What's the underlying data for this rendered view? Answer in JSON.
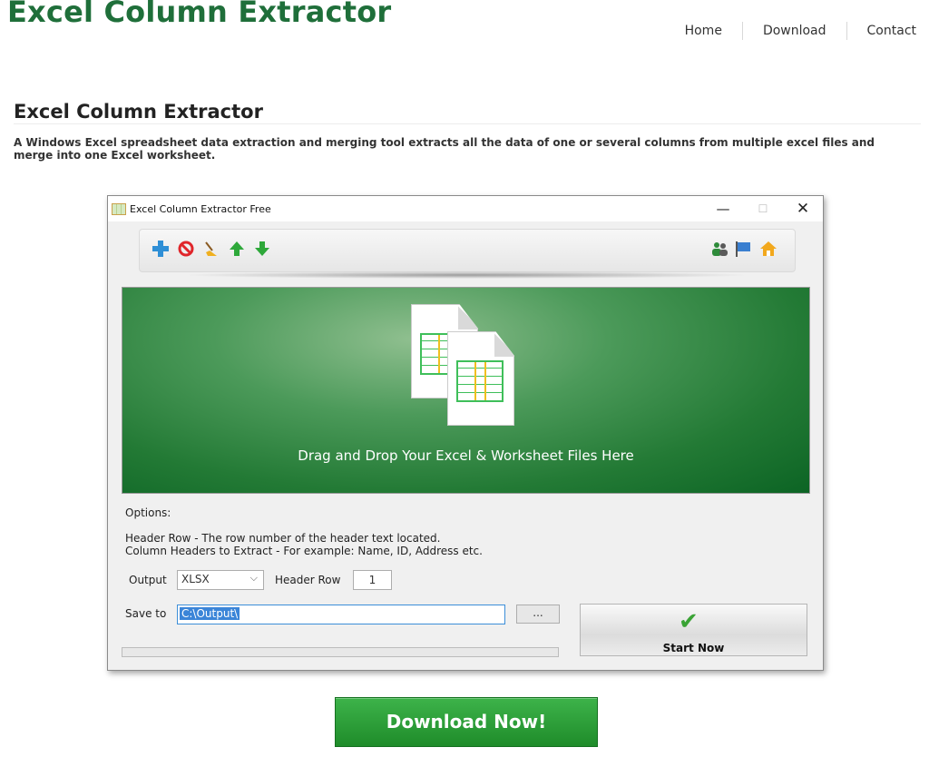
{
  "site": {
    "title": "Excel Column Extractor",
    "nav": [
      "Home",
      "Download",
      "Contact"
    ]
  },
  "page": {
    "heading": "Excel Column Extractor",
    "description": "A Windows Excel spreadsheet data extraction and merging tool extracts all the data of one or several columns from multiple excel files and merge into one Excel worksheet."
  },
  "app": {
    "window_title": "Excel Column Extractor Free",
    "toolbar_left_icons": [
      "add-icon",
      "remove-icon",
      "clear-icon",
      "move-up-icon",
      "move-down-icon"
    ],
    "toolbar_right_icons": [
      "users-icon",
      "flag-icon",
      "home-icon"
    ],
    "dropzone_text": "Drag and Drop Your Excel & Worksheet Files Here",
    "options_label": "Options:",
    "help_header_row": "Header Row - The row number of the header text located.",
    "help_column_headers": "Column Headers to Extract - For example: Name, ID, Address etc.",
    "output_label": "Output",
    "output_value": "XLSX",
    "header_row_label": "Header Row",
    "header_row_value": "1",
    "save_to_label": "Save to",
    "save_to_value": "C:\\Output\\",
    "browse_label": "...",
    "start_label": "Start Now"
  },
  "download": {
    "label": "Download Now!"
  },
  "colors": {
    "brand_green": "#1f6f3a",
    "button_green": "#2a9e37"
  }
}
